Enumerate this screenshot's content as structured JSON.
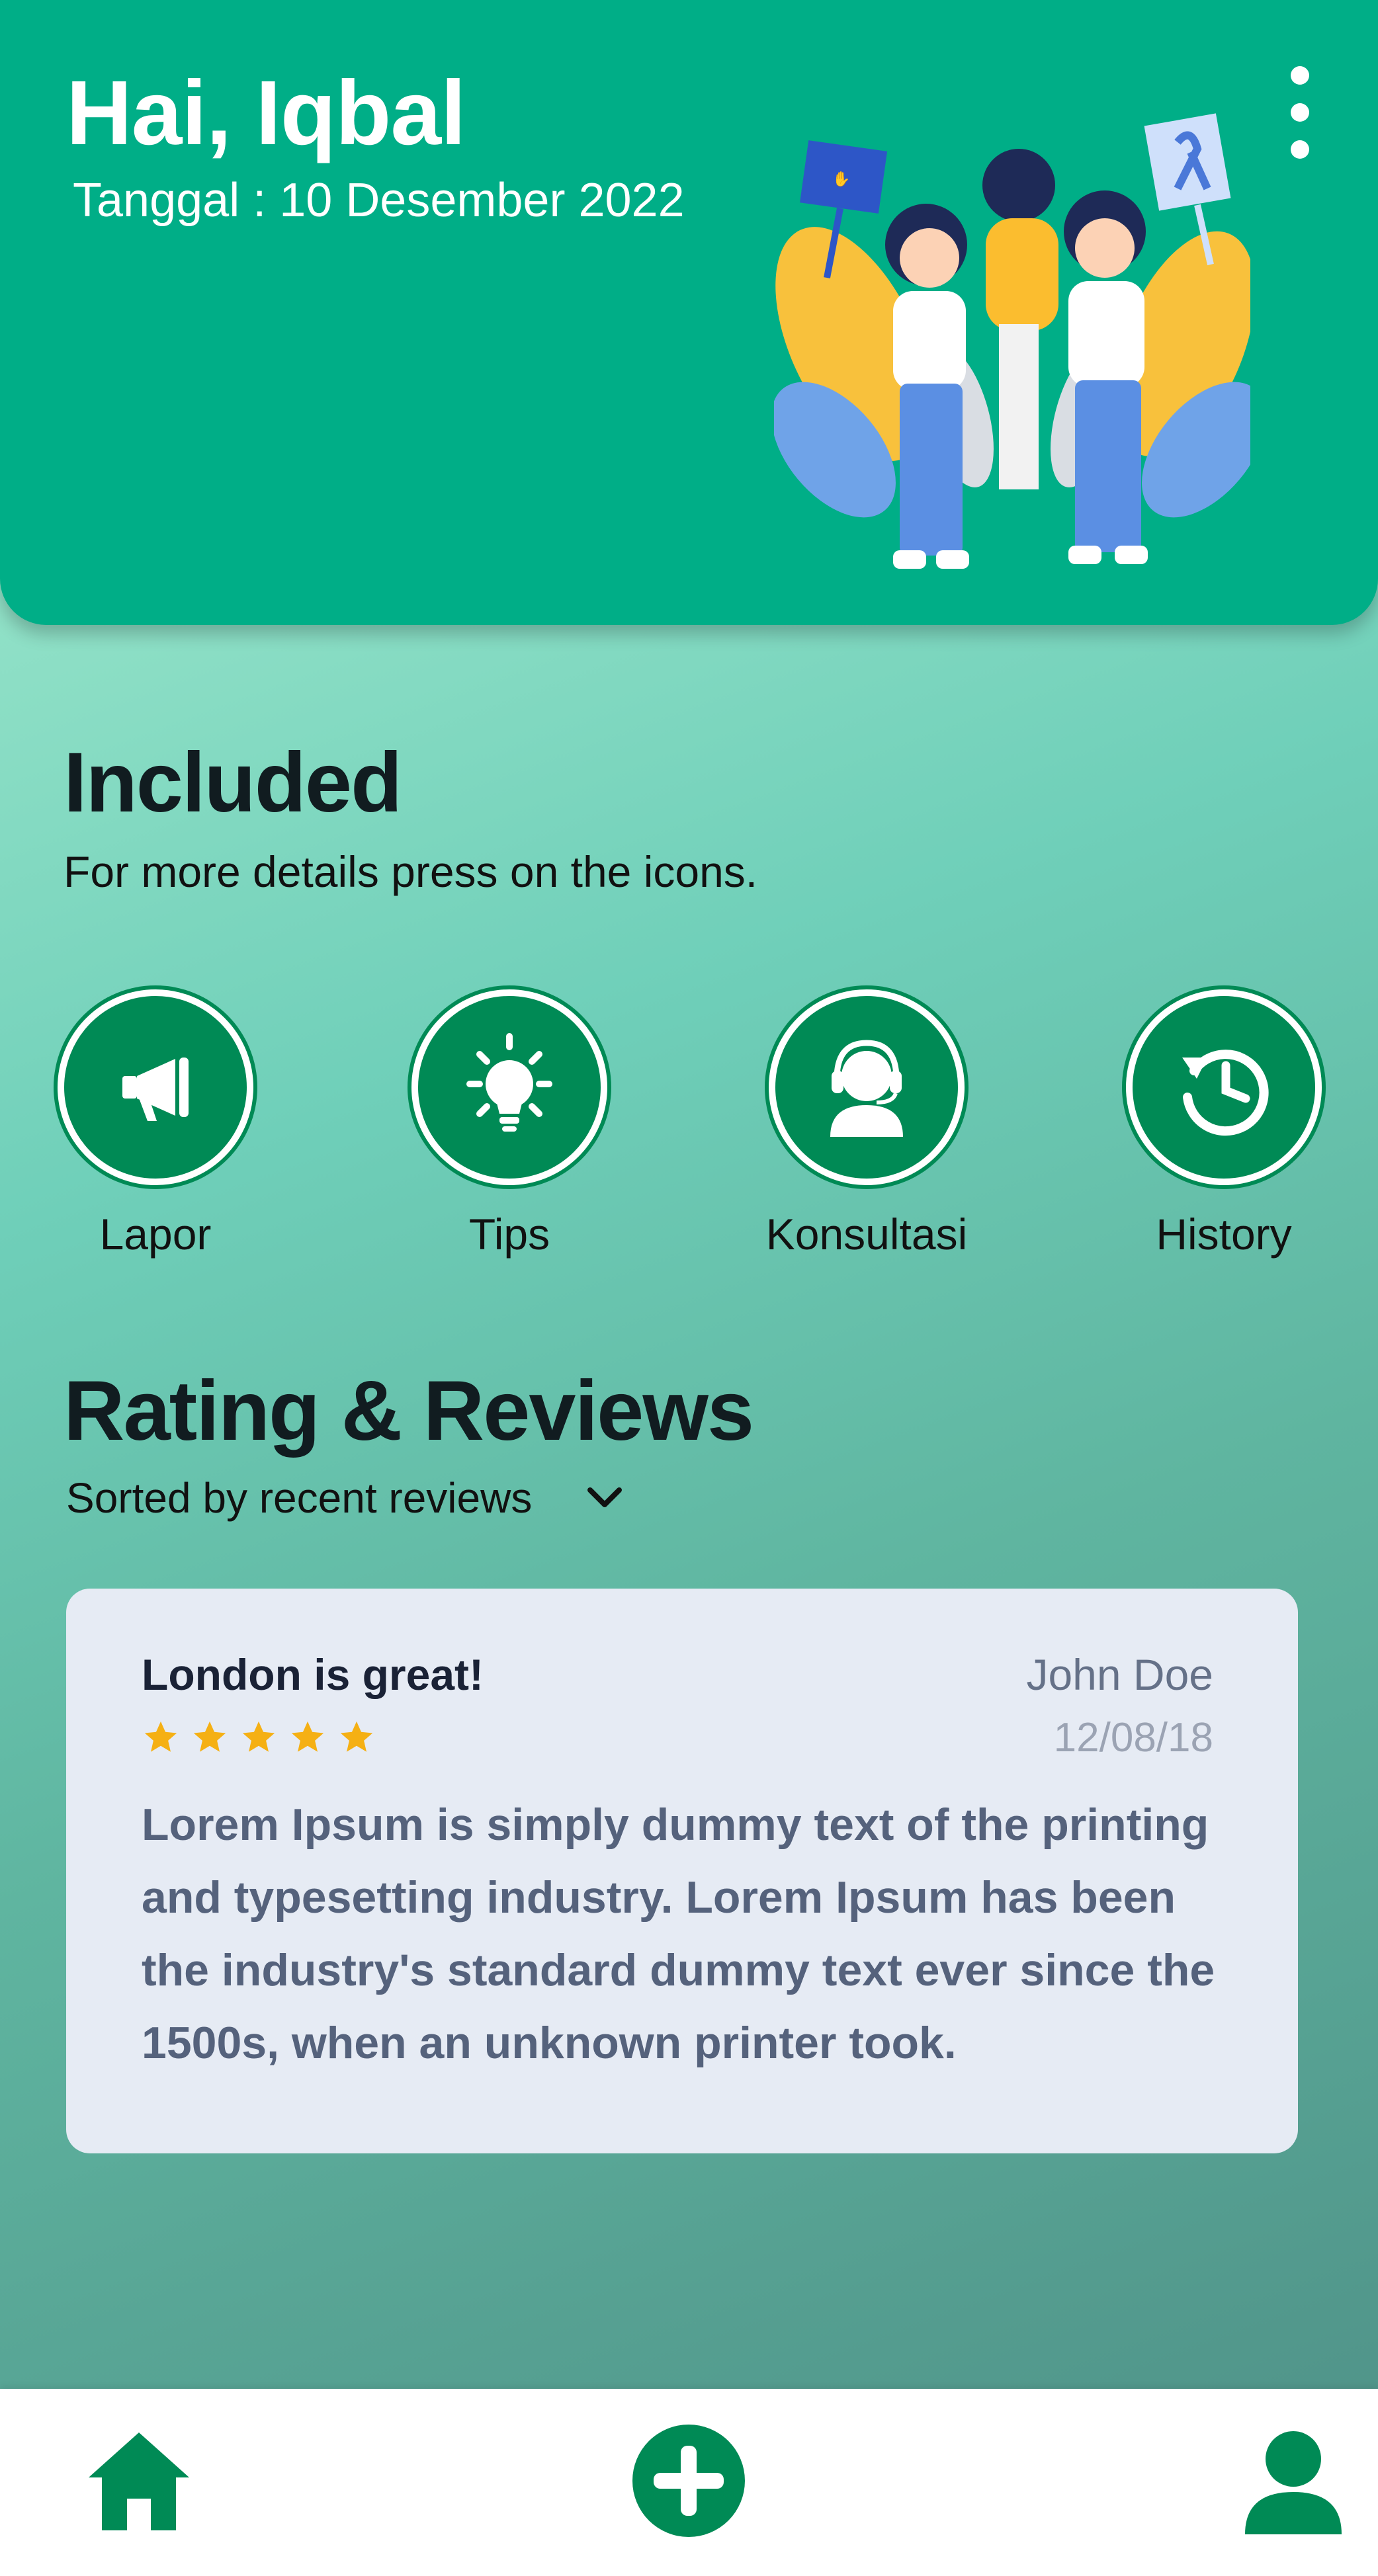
{
  "header": {
    "greeting": "Hai, Iqbal",
    "date": "Tanggal : 10 Desember 2022",
    "menu_icon": "more-vertical-icon",
    "illustration": "anti-bullying-students-illustration"
  },
  "included": {
    "title": "Included",
    "subtitle": "For more details press on the icons.",
    "items": [
      {
        "label": "Lapor",
        "icon": "megaphone-icon"
      },
      {
        "label": "Tips",
        "icon": "lightbulb-icon"
      },
      {
        "label": "Konsultasi",
        "icon": "headset-agent-icon"
      },
      {
        "label": "History",
        "icon": "history-icon"
      }
    ]
  },
  "reviews": {
    "title": "Rating & Reviews",
    "sort_label": "Sorted by recent reviews",
    "items": [
      {
        "title": "London is great!",
        "rating": 5,
        "author": "John Doe",
        "date": "12/08/18",
        "text": "Lorem Ipsum is simply dummy text of the printing and typesetting industry. Lorem Ipsum has been the industry's standard dummy text ever since the 1500s, when an unknown printer took."
      }
    ]
  },
  "bottom_nav": {
    "items": [
      {
        "icon": "home-icon"
      },
      {
        "icon": "add-circle-icon"
      },
      {
        "icon": "profile-icon"
      }
    ]
  },
  "colors": {
    "primary": "#00ae87",
    "icon_green": "#008a55",
    "star": "#f5b014",
    "card": "#e6ebf4"
  }
}
